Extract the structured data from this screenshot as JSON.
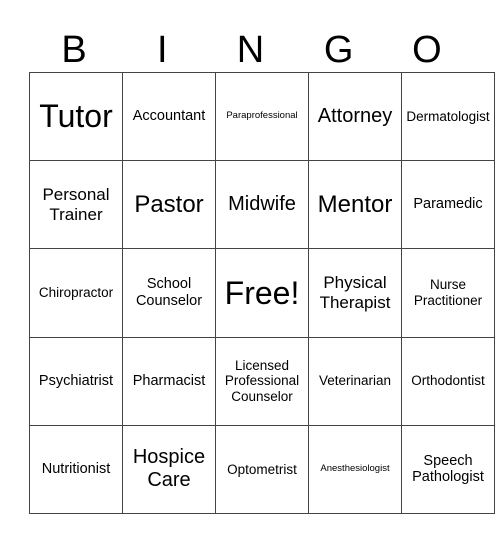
{
  "header": [
    "B",
    "I",
    "N",
    "G",
    "O"
  ],
  "rows": [
    [
      "Tutor",
      "Accountant",
      "Paraprofessional",
      "Attorney",
      "Dermatologist"
    ],
    [
      "Personal Trainer",
      "Pastor",
      "Midwife",
      "Mentor",
      "Paramedic"
    ],
    [
      "Chiropractor",
      "School Counselor",
      "Free!",
      "Physical Therapist",
      "Nurse Practitioner"
    ],
    [
      "Psychiatrist",
      "Pharmacist",
      "Licensed Professional Counselor",
      "Veterinarian",
      "Orthodontist"
    ],
    [
      "Nutritionist",
      "Hospice Care",
      "Optometrist",
      "Anesthesiologist",
      "Speech Pathologist"
    ]
  ]
}
